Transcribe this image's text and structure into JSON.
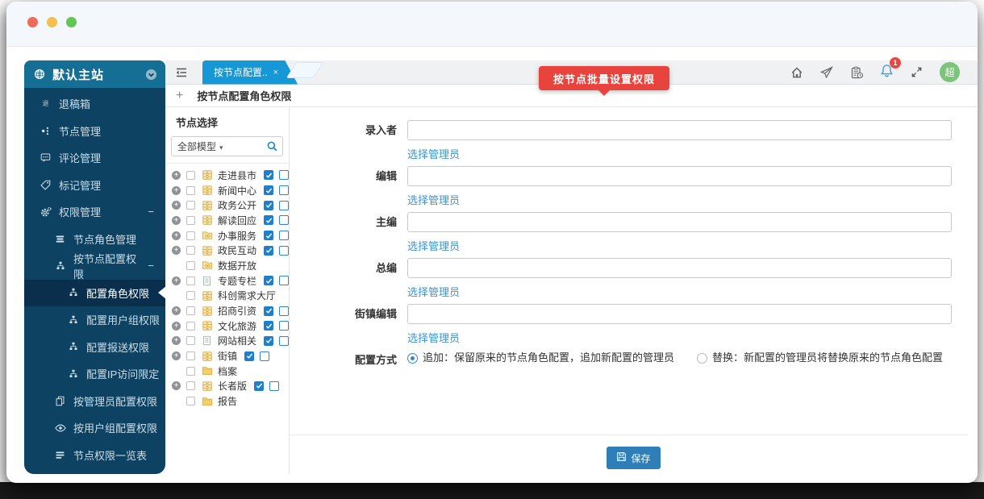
{
  "sidebar": {
    "site_title": "默认主站",
    "items": [
      {
        "label": "退稿箱",
        "icon": "return",
        "level": 0
      },
      {
        "label": "节点管理",
        "icon": "node",
        "level": 0
      },
      {
        "label": "评论管理",
        "icon": "comment",
        "level": 0
      },
      {
        "label": "标记管理",
        "icon": "tag",
        "level": 0
      },
      {
        "label": "权限管理",
        "icon": "gears",
        "level": 0,
        "minus": true
      },
      {
        "label": "节点角色管理",
        "icon": "roles",
        "level": 1
      },
      {
        "label": "按节点配置权限",
        "icon": "tree",
        "level": 1,
        "minus": true
      },
      {
        "label": "配置角色权限",
        "icon": "tree",
        "level": 2,
        "active": true
      },
      {
        "label": "配置用户组权限",
        "icon": "tree",
        "level": 2
      },
      {
        "label": "配置报送权限",
        "icon": "tree",
        "level": 2
      },
      {
        "label": "配置IP访问限定",
        "icon": "tree",
        "level": 2
      },
      {
        "label": "按管理员配置权限",
        "icon": "copy",
        "level": 1
      },
      {
        "label": "按用户组配置权限",
        "icon": "eye",
        "level": 1
      },
      {
        "label": "节点权限一览表",
        "icon": "list",
        "level": 1
      }
    ]
  },
  "tabbar": {
    "active_tab": "按节点配置..",
    "close_label": "×"
  },
  "page": {
    "add_label": "+",
    "title": "按节点配置角色权限"
  },
  "tooltip": {
    "text": "按节点批量设置权限"
  },
  "topbar": {
    "notification_count": "1",
    "avatar_text": "超"
  },
  "tree": {
    "header": "节点选择",
    "model_filter": "全部模型",
    "caret": "▾",
    "items": [
      {
        "label": "走进县市",
        "icon": "cabinet",
        "expand": true,
        "rights": true
      },
      {
        "label": "新闻中心",
        "icon": "cabinet",
        "expand": true,
        "rights": true
      },
      {
        "label": "政务公开",
        "icon": "cabinet",
        "expand": true,
        "rights": true
      },
      {
        "label": "解读回应",
        "icon": "cabinet",
        "expand": true,
        "rights": true
      },
      {
        "label": "办事服务",
        "icon": "foldere",
        "expand": true,
        "rights": true
      },
      {
        "label": "政民互动",
        "icon": "cabinet",
        "expand": true,
        "rights": true
      },
      {
        "label": "数据开放",
        "icon": "foldere",
        "expand": false,
        "rights": false
      },
      {
        "label": "专题专栏",
        "icon": "doc",
        "expand": true,
        "rights": true
      },
      {
        "label": "科创需求大厅",
        "icon": "cabinet",
        "expand": false,
        "rights": false
      },
      {
        "label": "招商引资",
        "icon": "cabinet",
        "expand": true,
        "rights": true
      },
      {
        "label": "文化旅游",
        "icon": "cabinet",
        "expand": true,
        "rights": true
      },
      {
        "label": "网站相关",
        "icon": "doc",
        "expand": true,
        "rights": true
      },
      {
        "label": "街镇",
        "icon": "cabinet",
        "expand": true,
        "rights": true
      },
      {
        "label": "档案",
        "icon": "folder",
        "expand": false,
        "rights": false
      },
      {
        "label": "长者版",
        "icon": "cabinet",
        "expand": true,
        "rights": true
      },
      {
        "label": "报告",
        "icon": "folder",
        "expand": false,
        "rights": false
      }
    ]
  },
  "form": {
    "fields": [
      {
        "label": "录入者",
        "link": "选择管理员"
      },
      {
        "label": "编辑",
        "link": "选择管理员"
      },
      {
        "label": "主编",
        "link": "选择管理员"
      },
      {
        "label": "总编",
        "link": "选择管理员"
      },
      {
        "label": "街镇编辑",
        "link": "选择管理员"
      }
    ],
    "config_label": "配置方式",
    "options": [
      {
        "text": "追加：保留原来的节点角色配置，追加新配置的管理员",
        "selected": true
      },
      {
        "text": "替换：新配置的管理员将替换原来的节点角色配置",
        "selected": false
      }
    ],
    "save_label": "保存"
  },
  "colors": {
    "sidebar_header": "#156f95",
    "sidebar_bg": "#0e4263",
    "active_item": "#0a2f4c",
    "tab_blue": "#1697d6",
    "tooltip_red": "#e8433c",
    "link_blue": "#3e94d1",
    "checkbox_blue": "#1d7fd0",
    "save_button": "#2e7eb8",
    "badge_red": "#e8483f",
    "avatar_green": "#7bc578"
  }
}
